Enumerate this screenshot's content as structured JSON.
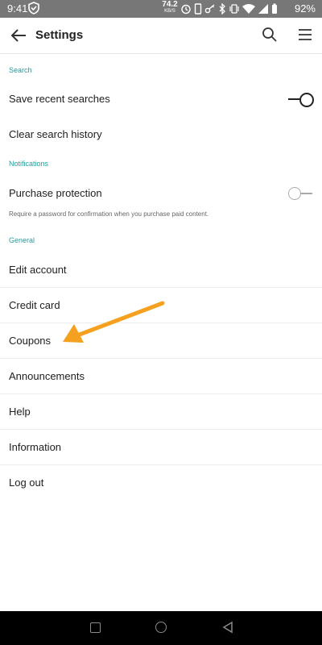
{
  "status_bar": {
    "time": "9:41",
    "net_speed_value": "74.2",
    "net_speed_unit": "KB/S",
    "battery": "92%",
    "icons": [
      "vpn-shield-icon",
      "alarm-icon",
      "phone-icon",
      "key-icon",
      "bluetooth-icon",
      "vibrate-icon",
      "wifi-icon",
      "signal-icon",
      "battery-icon"
    ]
  },
  "app_bar": {
    "title": "Settings",
    "icons": [
      "back-arrow-icon",
      "search-icon",
      "menu-icon"
    ]
  },
  "sections": {
    "search": {
      "header": "Search",
      "save_recent_label": "Save recent searches",
      "save_recent_on": true,
      "clear_history_label": "Clear search history"
    },
    "notifications": {
      "header": "Notifications",
      "purchase_protection_label": "Purchase protection",
      "purchase_protection_on": false,
      "purchase_protection_desc": "Require a password for confirmation when you purchase paid content."
    },
    "general": {
      "header": "General",
      "items": [
        "Edit account",
        "Credit card",
        "Coupons",
        "Announcements",
        "Help",
        "Information",
        "Log out"
      ]
    }
  },
  "annotation": {
    "arrow_color": "#F5A11F",
    "points_to": "Coupons"
  },
  "nav_bar": {
    "icons": [
      "recent-apps-icon",
      "home-icon",
      "back-icon"
    ]
  },
  "colors": {
    "accent": "#2A9C9C",
    "status_bar_bg": "#777777",
    "nav_bar_bg": "#000000"
  }
}
